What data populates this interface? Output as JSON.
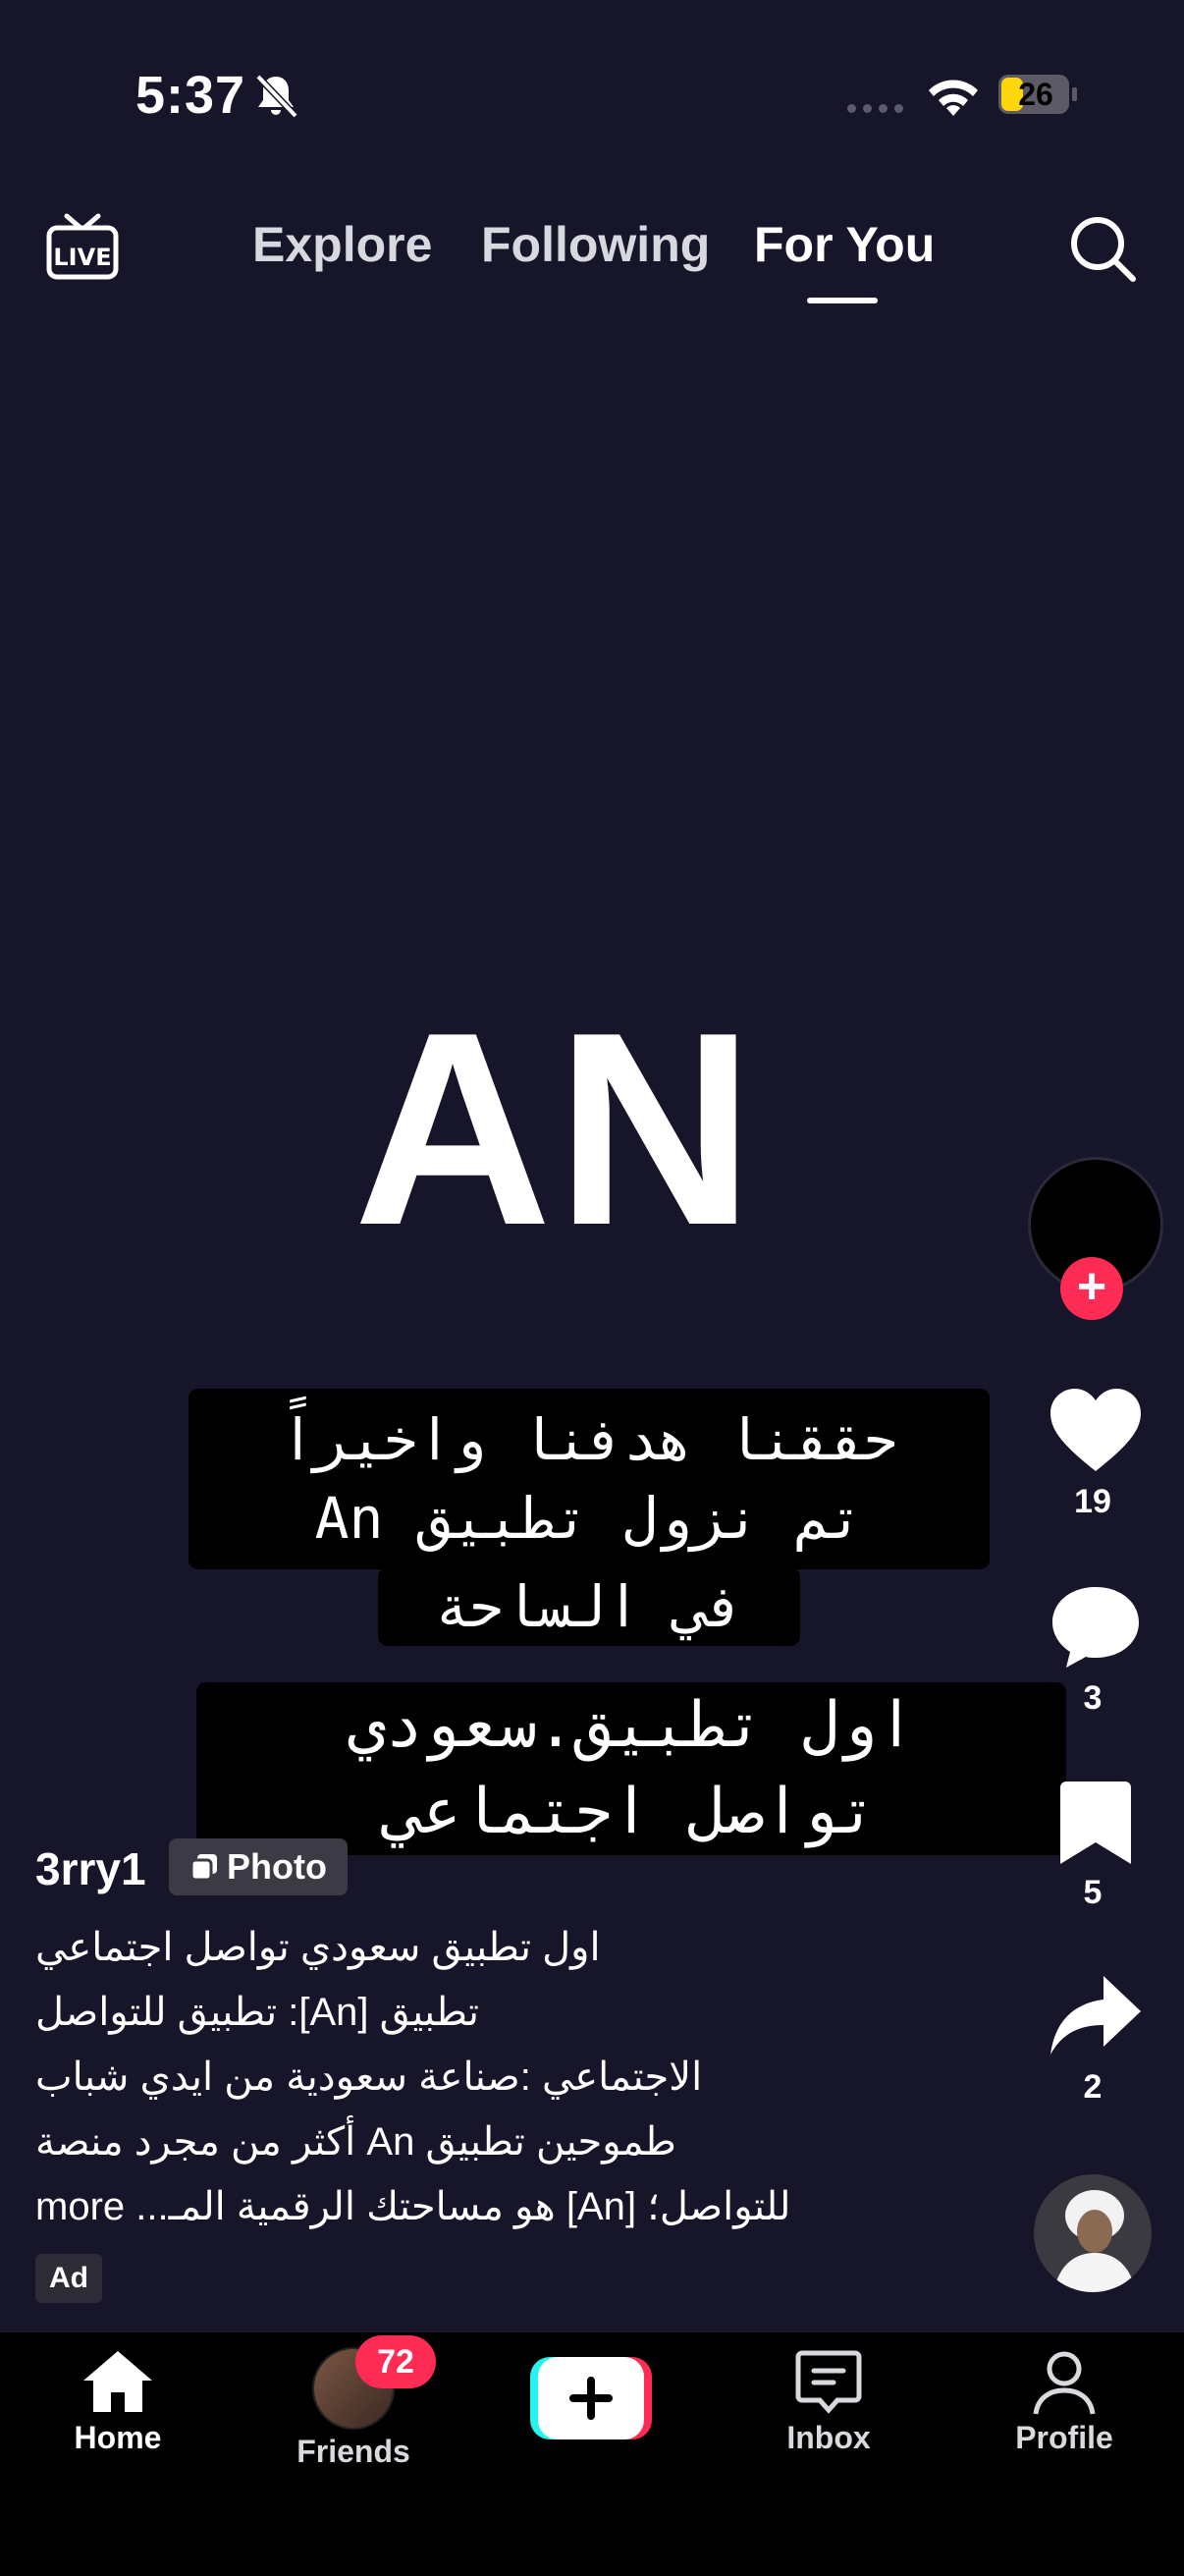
{
  "status_bar": {
    "time": "5:37",
    "battery": "26"
  },
  "top_nav": {
    "live_icon": "live-tv-icon",
    "tabs": [
      {
        "label": "Explore"
      },
      {
        "label": "Following"
      },
      {
        "label": "For You",
        "active": true
      }
    ],
    "search_icon": "search-icon"
  },
  "video": {
    "logo_text": "AN",
    "overlay_1": [
      "حققنا هدفنا واخيراً",
      "تم نزول تطبيق An",
      "في الساحة"
    ],
    "overlay_2": [
      "اول تطبيق.سعودي",
      "تواصل اجتماعي"
    ]
  },
  "right_rail": {
    "likes": "19",
    "comments": "3",
    "saves": "5",
    "shares": "2"
  },
  "caption": {
    "username": "3rry1",
    "badge": "Photo",
    "lines": [
      "اول تطبيق سعودي تواصل اجتماعي",
      "تطبيق [An]: تطبيق للتواصل",
      "الاجتماعي   :صناعة سعودية من ايدي شباب",
      "طموحين  تطبيق An أكثر من مجرد منصة",
      "للتواصل؛ [An] هو مساحتك الرقمية المـ... more"
    ],
    "ad_label": "Ad"
  },
  "bottom_nav": {
    "home": "Home",
    "friends": "Friends",
    "friends_badge": "72",
    "inbox": "Inbox",
    "profile": "Profile"
  },
  "colors": {
    "accent": "#fe2c55",
    "background": "#16152a",
    "cyan": "#25f4ee"
  }
}
